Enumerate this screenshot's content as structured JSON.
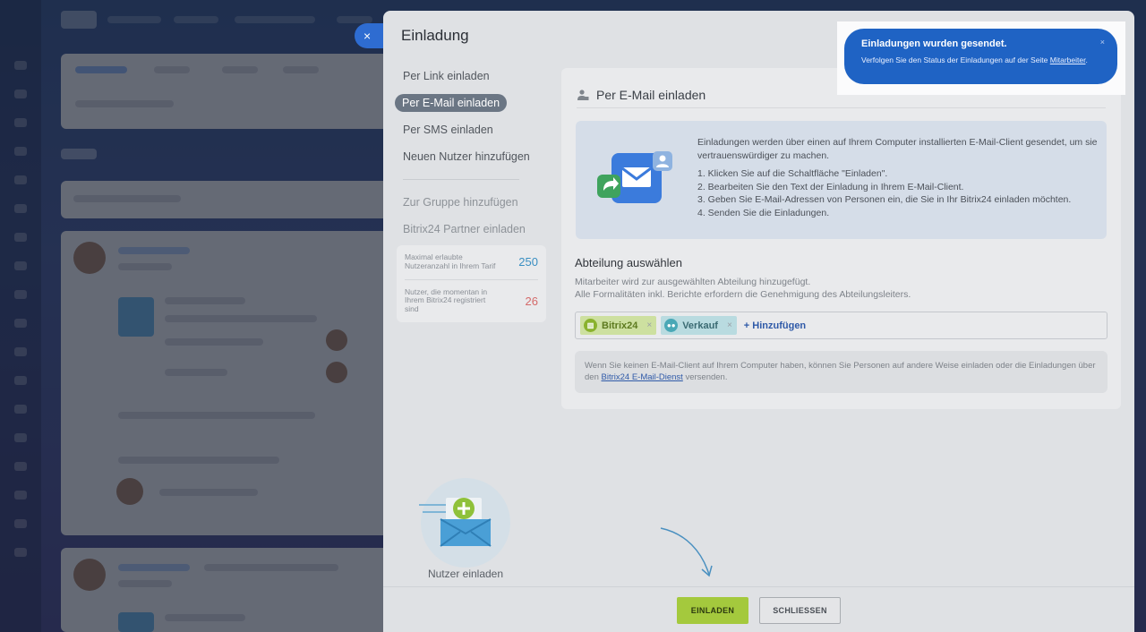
{
  "slider": {
    "close_icon": "×",
    "title": "Einladung"
  },
  "nav": {
    "items": [
      {
        "label": "Per Link einladen"
      },
      {
        "label": "Per E-Mail einladen"
      },
      {
        "label": "Per SMS einladen"
      },
      {
        "label": "Neuen Nutzer hinzufügen"
      },
      {
        "label": "Zur Gruppe hinzufügen"
      },
      {
        "label": "Bitrix24 Partner einladen"
      }
    ]
  },
  "stats": {
    "max_label": "Maximal erlaubte Nutzeranzahl in Ihrem Tarif",
    "max_value": "250",
    "current_label": "Nutzer, die momentan in Ihrem Bitrix24 registriert sind",
    "current_value": "26"
  },
  "content": {
    "header": "Per E-Mail einladen",
    "info_intro": "Einladungen werden über einen auf Ihrem Computer installierten E-Mail-Client gesendet, um sie vertrauenswürdiger zu machen.",
    "steps": [
      "1. Klicken Sie auf die Schaltfläche \"Einladen\".",
      "2. Bearbeiten Sie den Text der Einladung in Ihrem E-Mail-Client.",
      "3. Geben Sie E-Mail-Adressen von Personen ein, die Sie in Ihr Bitrix24 einladen möchten.",
      "4. Senden Sie die Einladungen."
    ],
    "dept_title": "Abteilung auswählen",
    "dept_desc_1": "Mitarbeiter wird zur ausgewählten Abteilung hinzugefügt.",
    "dept_desc_2": "Alle Formalitäten inkl. Berichte erfordern die Genehmigung des Abteilungsleiters.",
    "tags": [
      {
        "label": "Bitrix24"
      },
      {
        "label": "Verkauf"
      }
    ],
    "add_label": "+ Hinzufügen",
    "note_before": "Wenn Sie keinen E-Mail-Client auf Ihrem Computer haben, können Sie Personen auf andere Weise einladen oder die Einladungen über den ",
    "note_link": "Bitrix24 E-Mail-Dienst",
    "note_after": " versenden."
  },
  "illustration_label": "Nutzer einladen",
  "footer": {
    "invite_label": "EINLADEN",
    "close_label": "SCHLIESSEN"
  },
  "notification": {
    "title": "Einladungen wurden gesendet.",
    "text": "Verfolgen Sie den Status der Einladungen auf der Seite ",
    "link": "Mitarbeiter",
    "text_end": ".",
    "close": "×"
  },
  "colors": {
    "primary_button": "#a4c93d",
    "notification_bg": "#1f63c4",
    "active_nav": "#6b7684",
    "stat_blue": "#3a8fc2",
    "stat_red": "#d46a6a"
  }
}
